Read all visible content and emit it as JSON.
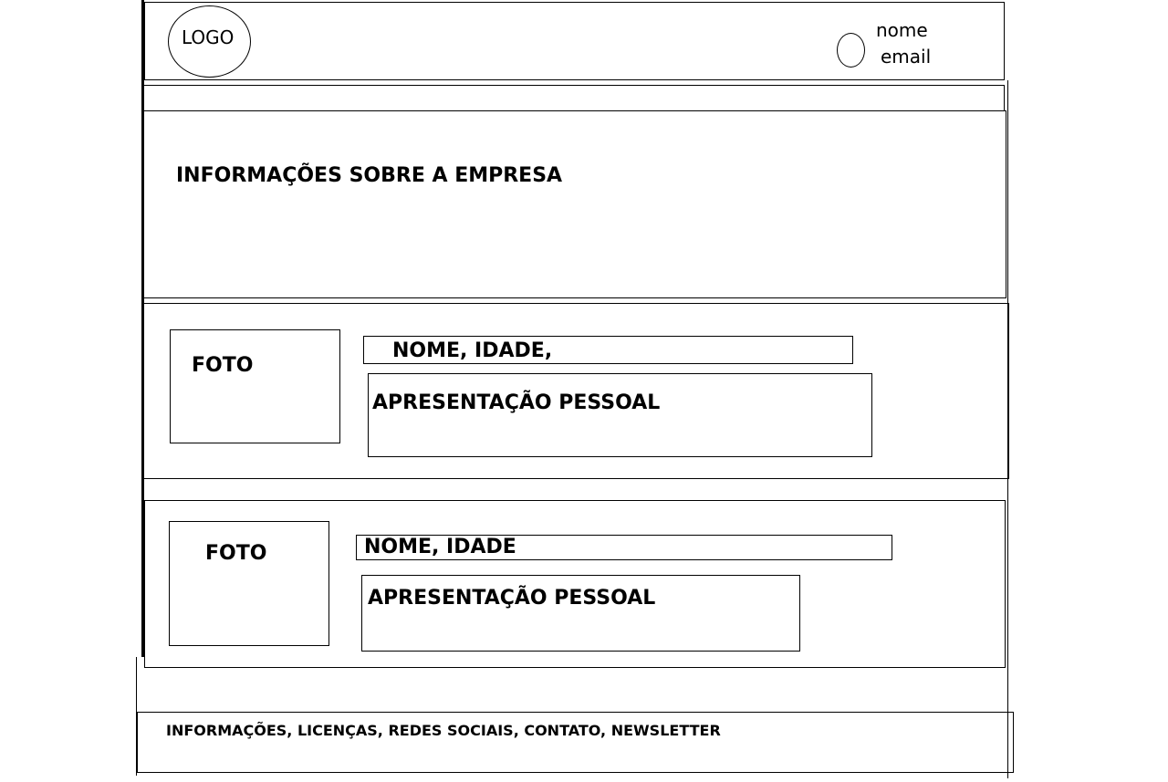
{
  "header": {
    "logo": "LOGO",
    "user_name": "nome",
    "user_email": "email"
  },
  "company_section": {
    "title": "INFORMAÇÕES SOBRE A EMPRESA"
  },
  "profiles": [
    {
      "photo": "FOTO",
      "name_age": "NOME, IDADE,",
      "presentation": "APRESENTAÇÃO PESSOAL"
    },
    {
      "photo": "FOTO",
      "name_age": "NOME, IDADE",
      "presentation": "APRESENTAÇÃO PESSOAL"
    }
  ],
  "footer": {
    "text": "INFORMAÇÕES, LICENÇAS, REDES SOCIAIS, CONTATO, NEWSLETTER"
  }
}
